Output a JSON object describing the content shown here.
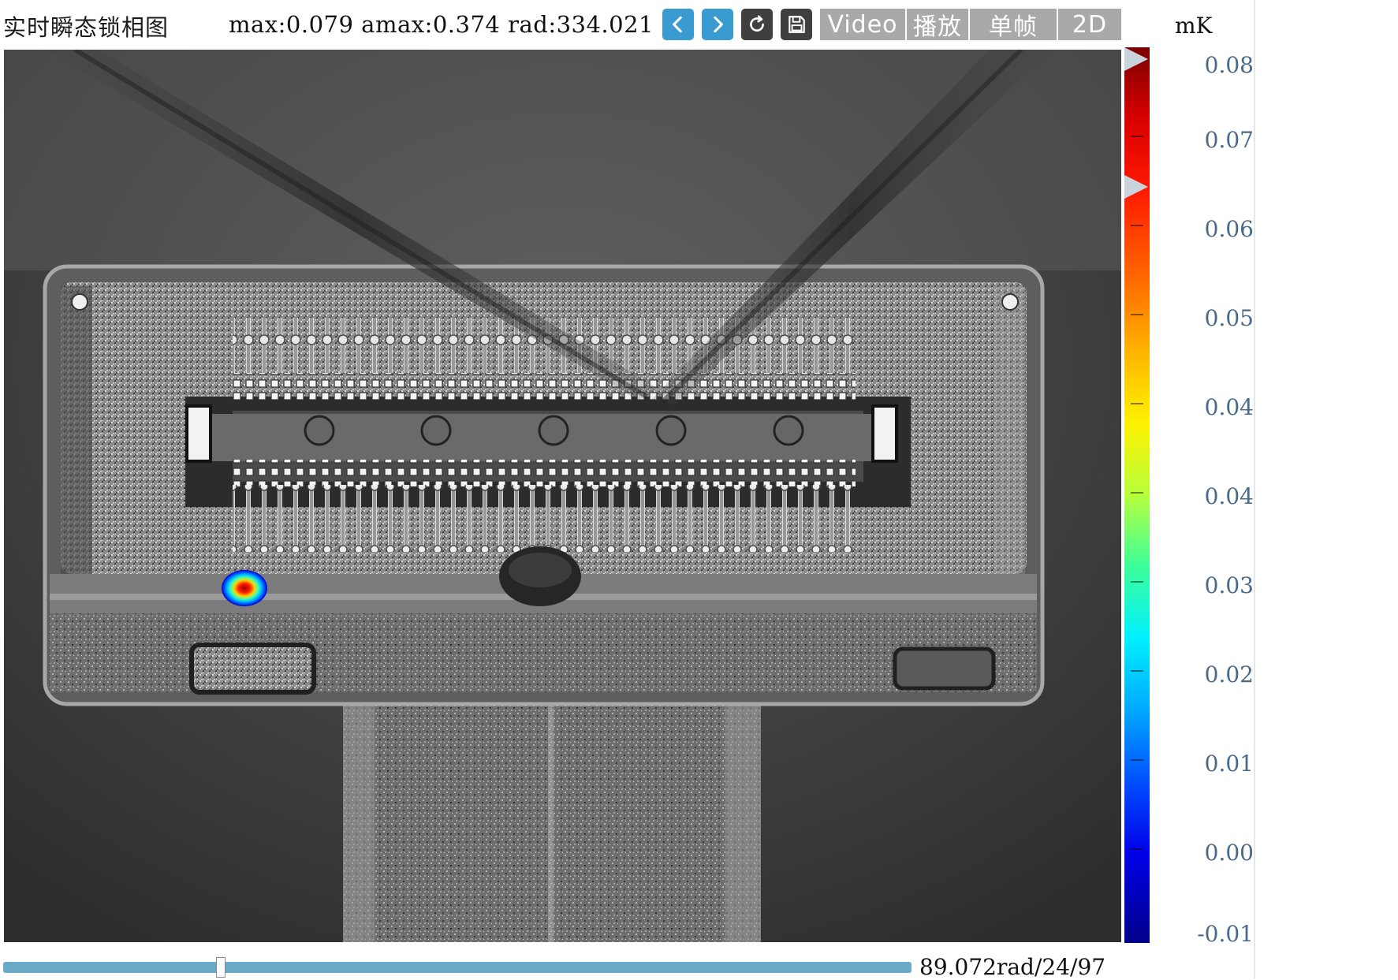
{
  "toolbar": {
    "title": "实时瞬态锁相图",
    "stats": "max:0.079 amax:0.374 rad:334.021",
    "buttons": {
      "prev": "chevron-left-icon",
      "next": "chevron-right-icon",
      "refresh": "refresh-icon",
      "save": "save-icon"
    },
    "tabs": [
      "Video",
      "播放",
      "单帧",
      "2D"
    ]
  },
  "colorbar": {
    "unit": "mK",
    "labels": [
      "0.08",
      "0.07",
      "0.06",
      "0.05",
      "0.04",
      "0.04",
      "0.03",
      "0.02",
      "0.01",
      "0.00",
      "-0.01"
    ],
    "colors": {
      "top": "#7a0000",
      "bottom": "#00008a"
    }
  },
  "slider": {
    "progress": 0.24,
    "frame_info": "89.072rad/24/97"
  }
}
